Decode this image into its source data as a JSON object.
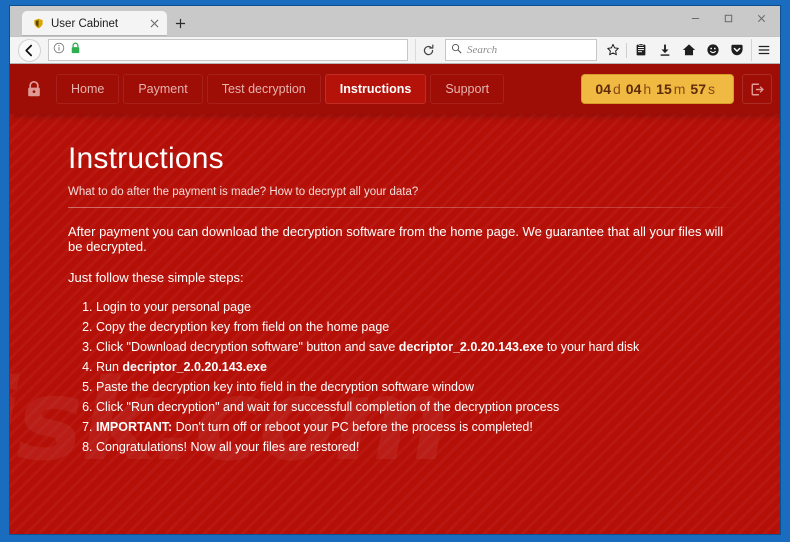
{
  "browser": {
    "tab": {
      "title": "User Cabinet",
      "favicon_icon": "shield-favicon",
      "close_icon": "close-icon"
    },
    "newtab_label": "+",
    "window_controls": {
      "minimize": "–",
      "maximize": "□",
      "close": "✕"
    },
    "back_icon": "back-arrow-icon",
    "identity_icon": "info-icon",
    "lock_icon": "green-lock-icon",
    "url_value": "",
    "url_placeholder": "",
    "reload_icon": "reload-icon",
    "search": {
      "placeholder": "Search",
      "icon": "search-icon"
    },
    "toolbar_icons": [
      {
        "name": "bookmark-star-icon",
        "glyph": "☆"
      },
      {
        "name": "library-icon",
        "glyph": "὜2"
      },
      {
        "name": "downloads-icon",
        "glyph": "⬇"
      },
      {
        "name": "home-icon",
        "glyph": "⌂"
      },
      {
        "name": "account-icon",
        "glyph": "☺"
      },
      {
        "name": "pocket-icon",
        "glyph": "▼"
      },
      {
        "name": "menu-hamburger-icon",
        "glyph": "☰"
      }
    ]
  },
  "site": {
    "brand_icon": "padlock-icon",
    "nav": [
      {
        "label": "Home",
        "active": false
      },
      {
        "label": "Payment",
        "active": false
      },
      {
        "label": "Test decryption",
        "active": false
      },
      {
        "label": "Instructions",
        "active": true
      },
      {
        "label": "Support",
        "active": false
      }
    ],
    "timer": {
      "days_value": "04",
      "days_unit": "d",
      "hours_value": "04",
      "hours_unit": "h",
      "minutes_value": "15",
      "minutes_unit": "m",
      "seconds_value": "57",
      "seconds_unit": "s"
    },
    "logout_icon": "logout-icon",
    "watermark": "isk.com"
  },
  "content": {
    "title": "Instructions",
    "subtitle": "What to do after the payment is made? How to decrypt all your data?",
    "paragraph1": "After payment you can download the decryption software from the home page. We guarantee that all your files will be decrypted.",
    "paragraph2": "Just follow these simple steps:",
    "steps": [
      {
        "prefix": "",
        "text": "Login to your personal page",
        "bold": "",
        "suffix": ""
      },
      {
        "prefix": "",
        "text": "Copy the decryption key from field on the home page",
        "bold": "",
        "suffix": ""
      },
      {
        "prefix": "",
        "text": "Click \"Download decryption software\" button and save ",
        "bold": "decriptor_2.0.20.143.exe",
        "suffix": " to your hard disk"
      },
      {
        "prefix": "",
        "text": "Run ",
        "bold": "decriptor_2.0.20.143.exe",
        "suffix": ""
      },
      {
        "prefix": "",
        "text": "Paste the decryption key into field in the decryption software window",
        "bold": "",
        "suffix": ""
      },
      {
        "prefix": "",
        "text": "Click \"Run decryption\" and wait for successfull completion of the decryption process",
        "bold": "",
        "suffix": ""
      },
      {
        "prefix": "IMPORTANT:",
        "text": " Don't turn off or reboot your PC before the process is completed!",
        "bold": "",
        "suffix": ""
      },
      {
        "prefix": "",
        "text": "Congratulations! Now all your files are restored!",
        "bold": "",
        "suffix": ""
      }
    ]
  },
  "colors": {
    "page_red": "#b51008",
    "header_red": "#9e0d06",
    "active_nav": "#b5120a",
    "timer_gold": "#f0b941",
    "desktop_blue": "#1a6cbf"
  }
}
